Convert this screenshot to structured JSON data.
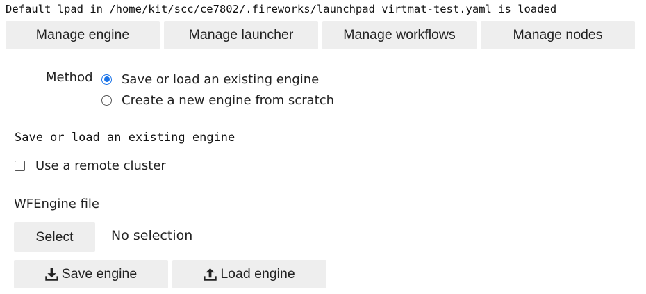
{
  "status_message": "Default lpad in /home/kit/scc/ce7802/.fireworks/launchpad_virtmat-test.yaml is loaded",
  "tabs": [
    {
      "label": "Manage engine"
    },
    {
      "label": "Manage launcher"
    },
    {
      "label": "Manage workflows"
    },
    {
      "label": "Manage nodes"
    }
  ],
  "method": {
    "label": "Method",
    "options": [
      {
        "label": "Save or load an existing engine",
        "selected": true
      },
      {
        "label": "Create a new engine from scratch",
        "selected": false
      }
    ]
  },
  "section_title": "Save or load an existing engine",
  "remote_cluster": {
    "label": "Use a remote cluster",
    "checked": false
  },
  "file_picker": {
    "label": "WFEngine file",
    "button_label": "Select",
    "selection_text": "No selection"
  },
  "actions": {
    "save": {
      "label": "Save engine",
      "icon": "download-icon"
    },
    "load": {
      "label": "Load engine",
      "icon": "upload-icon"
    }
  },
  "colors": {
    "accent": "#1a73e8",
    "button_bg": "#eeeeee"
  }
}
